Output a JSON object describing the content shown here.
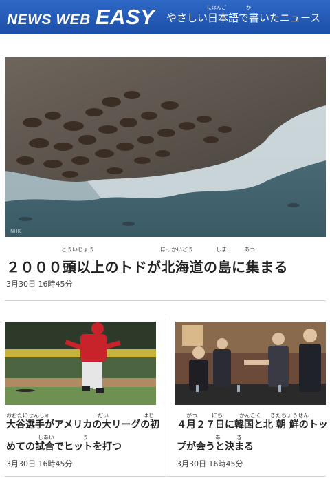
{
  "header": {
    "logo_news_web": "NEWS WEB",
    "logo_easy": "EASY",
    "tagline": "やさしい日本語で書いたニュース",
    "tagline_ruby": [
      "にほんご",
      "か"
    ]
  },
  "articles": [
    {
      "title": "２０００頭以上のトドが北海道の島に集まる",
      "ruby": [
        "とういじょう",
        "ほっかいどう",
        "しま",
        "あつ"
      ],
      "date": "3月30日 16時45分",
      "image_watermark": "NHK"
    },
    {
      "title_line1": "大谷選手がアメリカの大リーグの初",
      "title_line2": "めての試合でヒットを打つ",
      "ruby_line1": [
        "おおたにせんしゅ",
        "だい",
        "はじ"
      ],
      "ruby_line2": [
        "しあい",
        "う"
      ],
      "date": "3月30日 16時45分"
    },
    {
      "title_line1": "４月２７日に韓国と北 朝 鮮のトッ",
      "title_line2": "プが会うと決まる",
      "ruby_line1": [
        "がつ",
        "にち",
        "かんこく",
        "きたちょうせん"
      ],
      "ruby_line2": [
        "あ",
        "き"
      ],
      "date": "3月30日 16時45分"
    }
  ]
}
